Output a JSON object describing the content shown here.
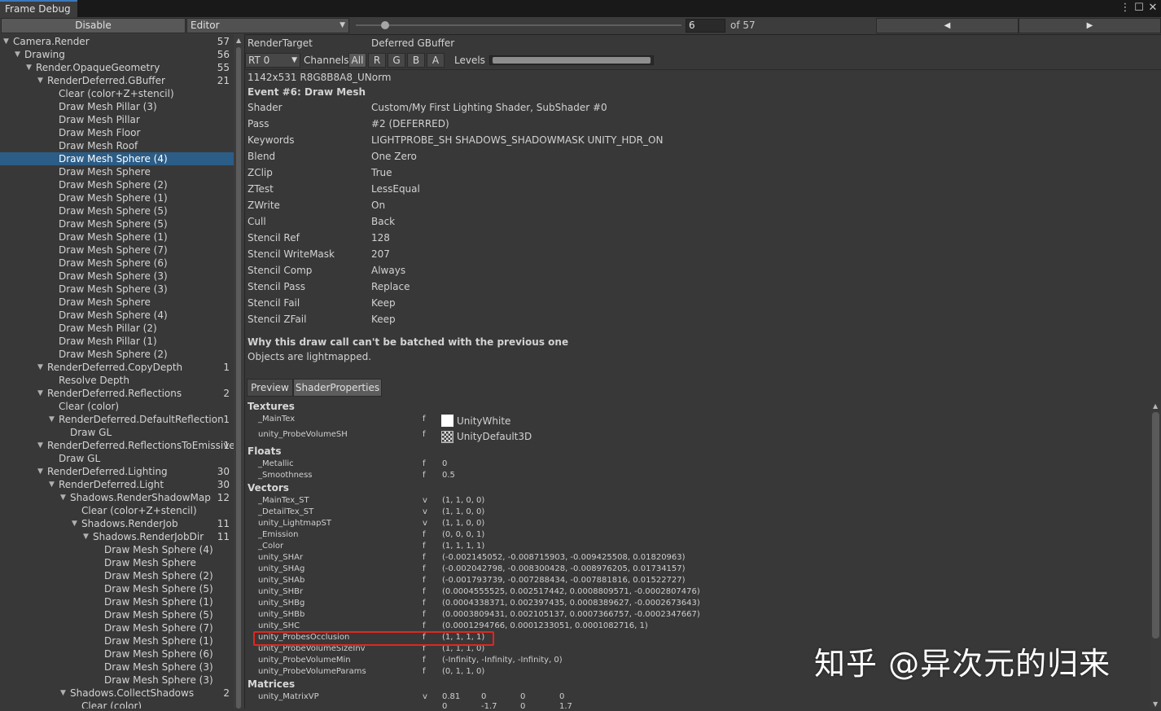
{
  "window": {
    "tab_title": "Frame Debug",
    "more_icon": "⋮",
    "maximize_icon": "☐",
    "close_icon": "✕"
  },
  "toolbar": {
    "disable_label": "Disable",
    "editor_dropdown": "Editor",
    "frame_value": "6",
    "of_label": "of 57",
    "prev_icon": "◀",
    "next_icon": "▶"
  },
  "tree": [
    {
      "label": "Camera.Render",
      "count": "57",
      "depth": 0,
      "expand": "down"
    },
    {
      "label": "Drawing",
      "count": "56",
      "depth": 1,
      "expand": "down"
    },
    {
      "label": "Render.OpaqueGeometry",
      "count": "55",
      "depth": 2,
      "expand": "down"
    },
    {
      "label": "RenderDeferred.GBuffer",
      "count": "21",
      "depth": 3,
      "expand": "down"
    },
    {
      "label": "Clear (color+Z+stencil)",
      "count": "",
      "depth": 4
    },
    {
      "label": "Draw Mesh Pillar (3)",
      "count": "",
      "depth": 4
    },
    {
      "label": "Draw Mesh Pillar",
      "count": "",
      "depth": 4
    },
    {
      "label": "Draw Mesh Floor",
      "count": "",
      "depth": 4
    },
    {
      "label": "Draw Mesh Roof",
      "count": "",
      "depth": 4
    },
    {
      "label": "Draw Mesh Sphere (4)",
      "count": "",
      "depth": 4,
      "selected": true
    },
    {
      "label": "Draw Mesh Sphere",
      "count": "",
      "depth": 4
    },
    {
      "label": "Draw Mesh Sphere (2)",
      "count": "",
      "depth": 4
    },
    {
      "label": "Draw Mesh Sphere (1)",
      "count": "",
      "depth": 4
    },
    {
      "label": "Draw Mesh Sphere (5)",
      "count": "",
      "depth": 4
    },
    {
      "label": "Draw Mesh Sphere (5)",
      "count": "",
      "depth": 4
    },
    {
      "label": "Draw Mesh Sphere (1)",
      "count": "",
      "depth": 4
    },
    {
      "label": "Draw Mesh Sphere (7)",
      "count": "",
      "depth": 4
    },
    {
      "label": "Draw Mesh Sphere (6)",
      "count": "",
      "depth": 4
    },
    {
      "label": "Draw Mesh Sphere (3)",
      "count": "",
      "depth": 4
    },
    {
      "label": "Draw Mesh Sphere (3)",
      "count": "",
      "depth": 4
    },
    {
      "label": "Draw Mesh Sphere",
      "count": "",
      "depth": 4
    },
    {
      "label": "Draw Mesh Sphere (4)",
      "count": "",
      "depth": 4
    },
    {
      "label": "Draw Mesh Pillar (2)",
      "count": "",
      "depth": 4
    },
    {
      "label": "Draw Mesh Pillar (1)",
      "count": "",
      "depth": 4
    },
    {
      "label": "Draw Mesh Sphere (2)",
      "count": "",
      "depth": 4
    },
    {
      "label": "RenderDeferred.CopyDepth",
      "count": "1",
      "depth": 3,
      "expand": "down"
    },
    {
      "label": "Resolve Depth",
      "count": "",
      "depth": 4
    },
    {
      "label": "RenderDeferred.Reflections",
      "count": "2",
      "depth": 3,
      "expand": "down"
    },
    {
      "label": "Clear (color)",
      "count": "",
      "depth": 4
    },
    {
      "label": "RenderDeferred.DefaultReflection",
      "count": "1",
      "depth": 4,
      "expand": "down"
    },
    {
      "label": "Draw GL",
      "count": "",
      "depth": 5
    },
    {
      "label": "RenderDeferred.ReflectionsToEmissive",
      "count": "1",
      "depth": 3,
      "expand": "down"
    },
    {
      "label": "Draw GL",
      "count": "",
      "depth": 4
    },
    {
      "label": "RenderDeferred.Lighting",
      "count": "30",
      "depth": 3,
      "expand": "down"
    },
    {
      "label": "RenderDeferred.Light",
      "count": "30",
      "depth": 4,
      "expand": "down"
    },
    {
      "label": "Shadows.RenderShadowMap",
      "count": "12",
      "depth": 5,
      "expand": "down"
    },
    {
      "label": "Clear (color+Z+stencil)",
      "count": "",
      "depth": 6
    },
    {
      "label": "Shadows.RenderJob",
      "count": "11",
      "depth": 6,
      "expand": "down"
    },
    {
      "label": "Shadows.RenderJobDir",
      "count": "11",
      "depth": 7,
      "expand": "down"
    },
    {
      "label": "Draw Mesh Sphere (4)",
      "count": "",
      "depth": 8
    },
    {
      "label": "Draw Mesh Sphere",
      "count": "",
      "depth": 8
    },
    {
      "label": "Draw Mesh Sphere (2)",
      "count": "",
      "depth": 8
    },
    {
      "label": "Draw Mesh Sphere (5)",
      "count": "",
      "depth": 8
    },
    {
      "label": "Draw Mesh Sphere (1)",
      "count": "",
      "depth": 8
    },
    {
      "label": "Draw Mesh Sphere (5)",
      "count": "",
      "depth": 8
    },
    {
      "label": "Draw Mesh Sphere (7)",
      "count": "",
      "depth": 8
    },
    {
      "label": "Draw Mesh Sphere (1)",
      "count": "",
      "depth": 8
    },
    {
      "label": "Draw Mesh Sphere (6)",
      "count": "",
      "depth": 8
    },
    {
      "label": "Draw Mesh Sphere (3)",
      "count": "",
      "depth": 8
    },
    {
      "label": "Draw Mesh Sphere (3)",
      "count": "",
      "depth": 8
    },
    {
      "label": "Shadows.CollectShadows",
      "count": "2",
      "depth": 5,
      "expand": "down"
    },
    {
      "label": "Clear (color)",
      "count": "",
      "depth": 6
    }
  ],
  "details": {
    "render_target_label": "RenderTarget",
    "render_target_value": "Deferred GBuffer",
    "rt_dropdown": "RT 0",
    "channels_label": "Channels",
    "channel_buttons": [
      "All",
      "R",
      "G",
      "B",
      "A"
    ],
    "levels_label": "Levels",
    "format": "1142x531 R8G8B8A8_UNorm",
    "event_title": "Event #6: Draw Mesh",
    "properties": [
      {
        "k": "Shader",
        "v": "Custom/My First Lighting Shader, SubShader #0"
      },
      {
        "k": "Pass",
        "v": "#2 (DEFERRED)"
      },
      {
        "k": "Keywords",
        "v": "LIGHTPROBE_SH SHADOWS_SHADOWMASK UNITY_HDR_ON"
      },
      {
        "k": "Blend",
        "v": "One Zero"
      },
      {
        "k": "ZClip",
        "v": "True"
      },
      {
        "k": "ZTest",
        "v": "LessEqual"
      },
      {
        "k": "ZWrite",
        "v": "On"
      },
      {
        "k": "Cull",
        "v": "Back"
      },
      {
        "k": "Stencil Ref",
        "v": "128"
      },
      {
        "k": "Stencil WriteMask",
        "v": "207"
      },
      {
        "k": "Stencil Comp",
        "v": "Always"
      },
      {
        "k": "Stencil Pass",
        "v": "Replace"
      },
      {
        "k": "Stencil Fail",
        "v": "Keep"
      },
      {
        "k": "Stencil ZFail",
        "v": "Keep"
      }
    ],
    "batch_title": "Why this draw call can't be batched with the previous one",
    "batch_reason": "Objects are lightmapped.",
    "tab_preview": "Preview",
    "tab_shader_properties": "ShaderProperties"
  },
  "shader_props": {
    "textures_header": "Textures",
    "textures": [
      {
        "name": "_MainTex",
        "type": "f",
        "value": "UnityWhite",
        "swatch": "#ffffff"
      },
      {
        "name": "unity_ProbeVolumeSH",
        "type": "f",
        "value": "UnityDefault3D",
        "swatch": "checker"
      }
    ],
    "floats_header": "Floats",
    "floats": [
      {
        "name": "_Metallic",
        "type": "f",
        "value": "0"
      },
      {
        "name": "_Smoothness",
        "type": "f",
        "value": "0.5"
      }
    ],
    "vectors_header": "Vectors",
    "vectors": [
      {
        "name": "_MainTex_ST",
        "type": "v",
        "value": "(1, 1, 0, 0)"
      },
      {
        "name": "_DetailTex_ST",
        "type": "v",
        "value": "(1, 1, 0, 0)"
      },
      {
        "name": "unity_LightmapST",
        "type": "v",
        "value": "(1, 1, 0, 0)"
      },
      {
        "name": "_Emission",
        "type": "f",
        "value": "(0, 0, 0, 1)"
      },
      {
        "name": "_Color",
        "type": "f",
        "value": "(1, 1, 1, 1)"
      },
      {
        "name": "unity_SHAr",
        "type": "f",
        "value": "(-0.002145052, -0.008715903, -0.009425508, 0.01820963)"
      },
      {
        "name": "unity_SHAg",
        "type": "f",
        "value": "(-0.002042798, -0.008300428, -0.008976205, 0.01734157)"
      },
      {
        "name": "unity_SHAb",
        "type": "f",
        "value": "(-0.001793739, -0.007288434, -0.007881816, 0.01522727)"
      },
      {
        "name": "unity_SHBr",
        "type": "f",
        "value": "(0.0004555525, 0.002517442, 0.0008809571, -0.0002807476)"
      },
      {
        "name": "unity_SHBg",
        "type": "f",
        "value": "(0.0004338371, 0.002397435, 0.0008389627, -0.0002673643)"
      },
      {
        "name": "unity_SHBb",
        "type": "f",
        "value": "(0.0003809431, 0.002105137, 0.0007366757, -0.0002347667)"
      },
      {
        "name": "unity_SHC",
        "type": "f",
        "value": "(0.0001294766, 0.0001233051, 0.0001082716, 1)"
      },
      {
        "name": "unity_ProbesOcclusion",
        "type": "f",
        "value": "(1, 1, 1, 1)"
      },
      {
        "name": "unity_ProbeVolumeSizeInv",
        "type": "f",
        "value": "(1, 1, 1, 0)"
      },
      {
        "name": "unity_ProbeVolumeMin",
        "type": "f",
        "value": "(-Infinity, -Infinity, -Infinity, 0)"
      },
      {
        "name": "unity_ProbeVolumeParams",
        "type": "f",
        "value": "(0, 1, 1, 0)"
      }
    ],
    "matrices_header": "Matrices",
    "matrix_name": "unity_MatrixVP",
    "matrix_type": "v",
    "matrix_row1": [
      "0.81",
      "0",
      "0",
      "0"
    ],
    "matrix_row2": [
      "0",
      "-1.7",
      "0",
      "1.7"
    ]
  },
  "watermark": "知乎 @异次元的归来",
  "colors": {
    "selection": "#2c5d87",
    "highlight_box": "#e0261f",
    "tab_accent": "#3a79bb"
  }
}
